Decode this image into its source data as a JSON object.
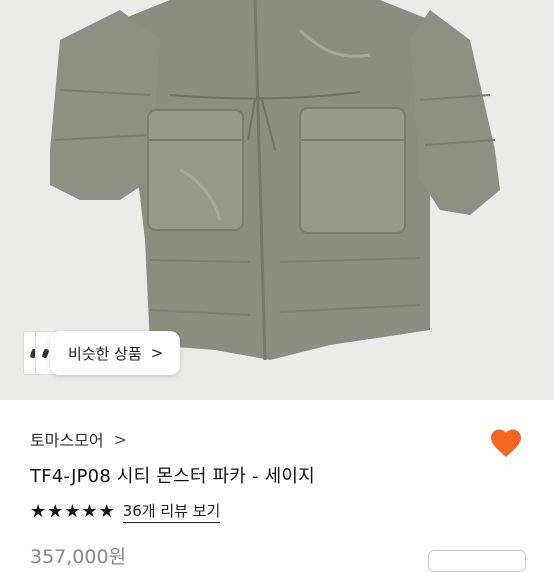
{
  "hero": {
    "image_alt": "product-photo-parka",
    "similar_button": {
      "label": "비슷한 상품",
      "chevron": ">"
    }
  },
  "product": {
    "brand": "토마스모어",
    "brand_chevron": ">",
    "title": "TF4-JP08 시티 몬스터 파카 - 세이지",
    "rating_stars": 5,
    "star_glyph": "★",
    "review_link": "36개 리뷰 보기",
    "price": "357,000원",
    "like_icon": "heart-icon",
    "like_color": "#f26522"
  }
}
